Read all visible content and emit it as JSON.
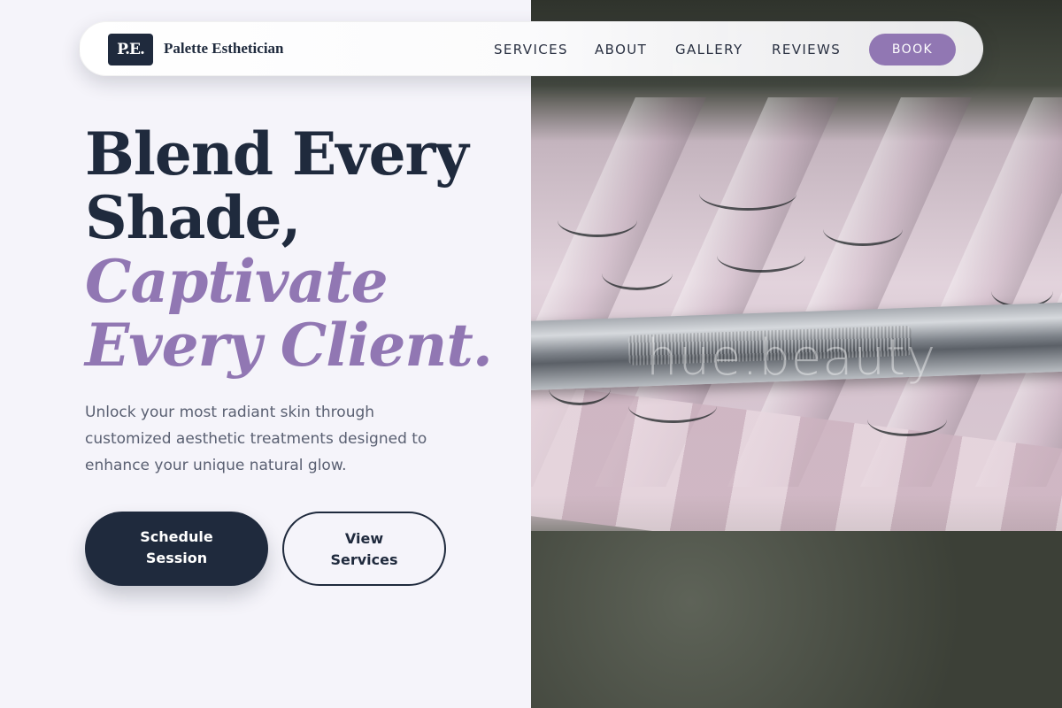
{
  "brand": {
    "mark": "P.E.",
    "name": "Palette Esthetician"
  },
  "nav": {
    "links": [
      "SERVICES",
      "ABOUT",
      "GALLERY",
      "REVIEWS"
    ],
    "book_label": "BOOK"
  },
  "hero": {
    "headline_line1": "Blend Every",
    "headline_line2": "Shade,",
    "headline_accent_line1": "Captivate",
    "headline_accent_line2": "Every Client.",
    "lead": "Unlock your most radiant skin through customized aesthetic treatments designed to enhance your unique natural glow.",
    "primary_cta_line1": "Schedule",
    "primary_cta_line2": "Session",
    "secondary_cta_line1": "View",
    "secondary_cta_line2": "Services"
  },
  "photo": {
    "watermark": "hue.beauty"
  },
  "colors": {
    "navy": "#1f2a3d",
    "accent": "#9177b3",
    "background": "#f5f4fa",
    "body_text": "#5a6072"
  },
  "icons": {
    "brand_mark": "pe-monogram"
  }
}
